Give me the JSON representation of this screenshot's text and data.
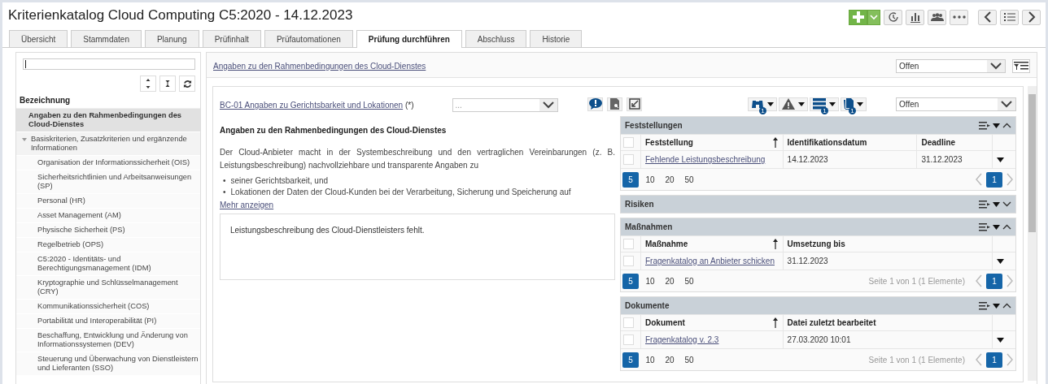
{
  "window": {
    "title": "Kriterienkatalog Cloud Computing C5:2020 - 14.12.2023"
  },
  "tabs": [
    {
      "label": "Übersicht",
      "selected": false
    },
    {
      "label": "Stammdaten",
      "selected": false
    },
    {
      "label": "Planung",
      "selected": false
    },
    {
      "label": "Prüfinhalt",
      "selected": false
    },
    {
      "label": "Prüfautomationen",
      "selected": false
    },
    {
      "label": "Prüfung durchführen",
      "selected": true
    },
    {
      "label": "Abschluss",
      "selected": false
    },
    {
      "label": "Historie",
      "selected": false
    }
  ],
  "sidebar": {
    "column_header": "Bezeichnung",
    "items": [
      {
        "label": "Angaben zu den Rahmenbedingungen des Cloud-Dienstes",
        "selected": true
      },
      {
        "label": "Basiskriterien, Zusatzkriterien und ergänzende Informationen",
        "selected": false,
        "expanded": true,
        "children": [
          {
            "label": "Organisation der Informationssicherheit (OIS)",
            "selected": false
          },
          {
            "label": "Sicherheitsrichtlinien und Arbeitsanweisungen (SP)",
            "selected": false
          },
          {
            "label": "Personal (HR)",
            "selected": false
          },
          {
            "label": "Asset Management (AM)",
            "selected": false
          },
          {
            "label": "Physische Sicherheit (PS)",
            "selected": false
          },
          {
            "label": "Regelbetrieb (OPS)",
            "selected": false
          },
          {
            "label": "C5:2020 - Identitäts- und Berechtigungsmanagement (IDM)",
            "selected": false
          },
          {
            "label": "Kryptographie und Schlüsselmanagement (CRY)",
            "selected": false
          },
          {
            "label": "Kommunikationssicherheit (COS)",
            "selected": false
          },
          {
            "label": "Portabilität und Interoperabilität (PI)",
            "selected": false
          },
          {
            "label": "Beschaffung, Entwicklung und Änderung von Informationssystemen (DEV)",
            "selected": false
          },
          {
            "label": "Steuerung und Überwachung von Dienstleistern und Lieferanten (SSO)",
            "selected": false
          }
        ]
      }
    ]
  },
  "breadcrumb": "Angaben zu den Rahmenbedingungen des Cloud-Dienstes",
  "header_status": "Offen",
  "criterion": {
    "link": "BC-01 Angaben zu Gerichtsbarkeit und Lokationen",
    "suffix": "(*)",
    "rating_placeholder": "...",
    "status": "Offen",
    "tools": [
      {
        "kind": "binoculars",
        "badge": "1"
      },
      {
        "kind": "warning"
      },
      {
        "kind": "list",
        "badge": "1"
      },
      {
        "kind": "document",
        "badge": "1"
      }
    ],
    "heading": "Angaben zu den Rahmenbedingungen des Cloud-Dienstes",
    "paragraph": "Der Cloud-Anbieter macht in der Systembeschreibung und den vertraglichen Vereinbarungen (z. B. Leistungsbeschreibung) nachvollziehbare und transparente Angaben zu",
    "bullets": [
      {
        "marker": "•",
        "text": "seiner Gerichtsbarkeit, und"
      },
      {
        "marker": "•",
        "text": "Lokationen der Daten der Cloud-Kunden bei der Verarbeitung, Sicherung und Speicherung auf"
      }
    ],
    "more_link": "Mehr anzeigen",
    "note": "Leistungsbeschreibung des Cloud-Dienstleisters fehlt."
  },
  "sections": [
    {
      "title": "Feststellungen",
      "expanded": true,
      "columns": [
        "Feststellung",
        "Identifikationsdatum",
        "Deadline"
      ],
      "all_checked": false,
      "rows": [
        {
          "checked": false,
          "cells": [
            "Fehlende Leistungsbeschreibung",
            "14.12.2023",
            "31.12.2023"
          ]
        }
      ],
      "page_sizes": [
        {
          "label": "5",
          "selected": true
        },
        {
          "label": "10",
          "selected": false
        },
        {
          "label": "20",
          "selected": false
        },
        {
          "label": "50",
          "selected": false
        }
      ],
      "pages": [
        {
          "label": "1",
          "selected": true
        }
      ]
    },
    {
      "title": "Risiken",
      "expanded": false
    },
    {
      "title": "Maßnahmen",
      "expanded": true,
      "columns": [
        "Maßnahme",
        "Umsetzung bis"
      ],
      "all_checked": false,
      "rows": [
        {
          "checked": false,
          "cells": [
            "Fragenkatalog an Anbieter schicken",
            "31.12.2023"
          ]
        }
      ],
      "page_sizes": [
        {
          "label": "5",
          "selected": true
        },
        {
          "label": "10",
          "selected": false
        },
        {
          "label": "20",
          "selected": false
        },
        {
          "label": "50",
          "selected": false
        }
      ],
      "summary": "Seite 1 von 1 (1 Elemente)",
      "pages": [
        {
          "label": "1",
          "selected": true
        }
      ]
    },
    {
      "title": "Dokumente",
      "expanded": true,
      "columns": [
        "Dokument",
        "Datei zuletzt bearbeitet"
      ],
      "all_checked": false,
      "rows": [
        {
          "checked": false,
          "cells": [
            "Fragenkatalog v. 2.3",
            "27.03.2020 10:01"
          ]
        }
      ],
      "page_sizes": [
        {
          "label": "5",
          "selected": true
        },
        {
          "label": "10",
          "selected": false
        },
        {
          "label": "20",
          "selected": false
        },
        {
          "label": "50",
          "selected": false
        }
      ],
      "summary": "Seite 1 von 1 (1 Elemente)",
      "pages": [
        {
          "label": "1",
          "selected": true
        }
      ]
    }
  ]
}
